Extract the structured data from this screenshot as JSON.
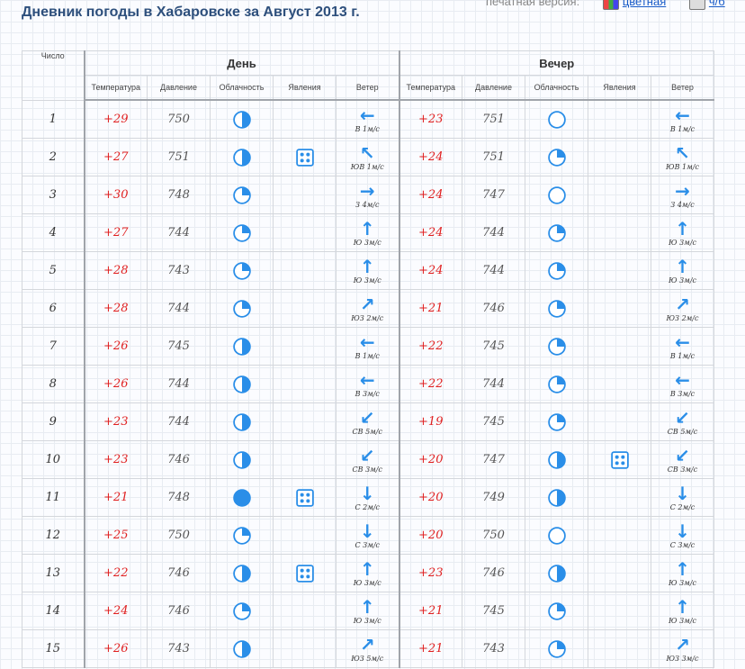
{
  "page": {
    "title": "Дневник погоды в Хабаровске за Август 2013 г.",
    "print_label": "печатная версия:",
    "print_color_link": "цветная",
    "print_bw_link": "ч/б"
  },
  "colors": {
    "temp": "#e02020",
    "icon_blue": "#2a8ee8",
    "title": "#2d4f7c"
  },
  "table": {
    "col_day": "Число",
    "group_day": "День",
    "group_evening": "Вечер",
    "sub_headers": [
      "Температура",
      "Давление",
      "Облачность",
      "Явления",
      "Ветер"
    ]
  },
  "rows": [
    {
      "day": "1",
      "d": {
        "temp": "+29",
        "pres": "750",
        "cloud": "half",
        "phen": "",
        "dir": "В",
        "speed": "1м/с"
      },
      "e": {
        "temp": "+23",
        "pres": "751",
        "cloud": "clear",
        "phen": "",
        "dir": "В",
        "speed": "1м/с"
      }
    },
    {
      "day": "2",
      "d": {
        "temp": "+27",
        "pres": "751",
        "cloud": "half",
        "phen": "rain",
        "dir": "ЮВ",
        "speed": "1м/с"
      },
      "e": {
        "temp": "+24",
        "pres": "751",
        "cloud": "quarter",
        "phen": "",
        "dir": "ЮВ",
        "speed": "1м/с"
      }
    },
    {
      "day": "3",
      "d": {
        "temp": "+30",
        "pres": "748",
        "cloud": "quarter",
        "phen": "",
        "dir": "З",
        "speed": "4м/с"
      },
      "e": {
        "temp": "+24",
        "pres": "747",
        "cloud": "clear",
        "phen": "",
        "dir": "З",
        "speed": "4м/с"
      }
    },
    {
      "day": "4",
      "d": {
        "temp": "+27",
        "pres": "744",
        "cloud": "quarter",
        "phen": "",
        "dir": "Ю",
        "speed": "3м/с"
      },
      "e": {
        "temp": "+24",
        "pres": "744",
        "cloud": "quarter",
        "phen": "",
        "dir": "Ю",
        "speed": "3м/с"
      }
    },
    {
      "day": "5",
      "d": {
        "temp": "+28",
        "pres": "743",
        "cloud": "quarter",
        "phen": "",
        "dir": "Ю",
        "speed": "3м/с"
      },
      "e": {
        "temp": "+24",
        "pres": "744",
        "cloud": "quarter",
        "phen": "",
        "dir": "Ю",
        "speed": "3м/с"
      }
    },
    {
      "day": "6",
      "d": {
        "temp": "+28",
        "pres": "744",
        "cloud": "quarter",
        "phen": "",
        "dir": "ЮЗ",
        "speed": "2м/с"
      },
      "e": {
        "temp": "+21",
        "pres": "746",
        "cloud": "quarter",
        "phen": "",
        "dir": "ЮЗ",
        "speed": "2м/с"
      }
    },
    {
      "day": "7",
      "d": {
        "temp": "+26",
        "pres": "745",
        "cloud": "half",
        "phen": "",
        "dir": "В",
        "speed": "1м/с"
      },
      "e": {
        "temp": "+22",
        "pres": "745",
        "cloud": "quarter",
        "phen": "",
        "dir": "В",
        "speed": "1м/с"
      }
    },
    {
      "day": "8",
      "d": {
        "temp": "+26",
        "pres": "744",
        "cloud": "half",
        "phen": "",
        "dir": "В",
        "speed": "3м/с"
      },
      "e": {
        "temp": "+22",
        "pres": "744",
        "cloud": "quarter",
        "phen": "",
        "dir": "В",
        "speed": "3м/с"
      }
    },
    {
      "day": "9",
      "d": {
        "temp": "+23",
        "pres": "744",
        "cloud": "half",
        "phen": "",
        "dir": "СВ",
        "speed": "5м/с"
      },
      "e": {
        "temp": "+19",
        "pres": "745",
        "cloud": "quarter",
        "phen": "",
        "dir": "СВ",
        "speed": "5м/с"
      }
    },
    {
      "day": "10",
      "d": {
        "temp": "+23",
        "pres": "746",
        "cloud": "half",
        "phen": "",
        "dir": "СВ",
        "speed": "3м/с"
      },
      "e": {
        "temp": "+20",
        "pres": "747",
        "cloud": "half",
        "phen": "rain",
        "dir": "СВ",
        "speed": "3м/с"
      }
    },
    {
      "day": "11",
      "d": {
        "temp": "+21",
        "pres": "748",
        "cloud": "full",
        "phen": "rain",
        "dir": "С",
        "speed": "2м/с"
      },
      "e": {
        "temp": "+20",
        "pres": "749",
        "cloud": "half",
        "phen": "",
        "dir": "С",
        "speed": "2м/с"
      }
    },
    {
      "day": "12",
      "d": {
        "temp": "+25",
        "pres": "750",
        "cloud": "quarter",
        "phen": "",
        "dir": "С",
        "speed": "3м/с"
      },
      "e": {
        "temp": "+20",
        "pres": "750",
        "cloud": "clear",
        "phen": "",
        "dir": "С",
        "speed": "3м/с"
      }
    },
    {
      "day": "13",
      "d": {
        "temp": "+22",
        "pres": "746",
        "cloud": "half",
        "phen": "rain",
        "dir": "Ю",
        "speed": "3м/с"
      },
      "e": {
        "temp": "+23",
        "pres": "746",
        "cloud": "half",
        "phen": "",
        "dir": "Ю",
        "speed": "3м/с"
      }
    },
    {
      "day": "14",
      "d": {
        "temp": "+24",
        "pres": "746",
        "cloud": "quarter",
        "phen": "",
        "dir": "Ю",
        "speed": "3м/с"
      },
      "e": {
        "temp": "+21",
        "pres": "745",
        "cloud": "quarter",
        "phen": "",
        "dir": "Ю",
        "speed": "3м/с"
      }
    },
    {
      "day": "15",
      "d": {
        "temp": "+26",
        "pres": "743",
        "cloud": "half",
        "phen": "",
        "dir": "ЮЗ",
        "speed": "5м/с"
      },
      "e": {
        "temp": "+21",
        "pres": "743",
        "cloud": "quarter",
        "phen": "",
        "dir": "ЮЗ",
        "speed": "3м/с"
      }
    }
  ]
}
